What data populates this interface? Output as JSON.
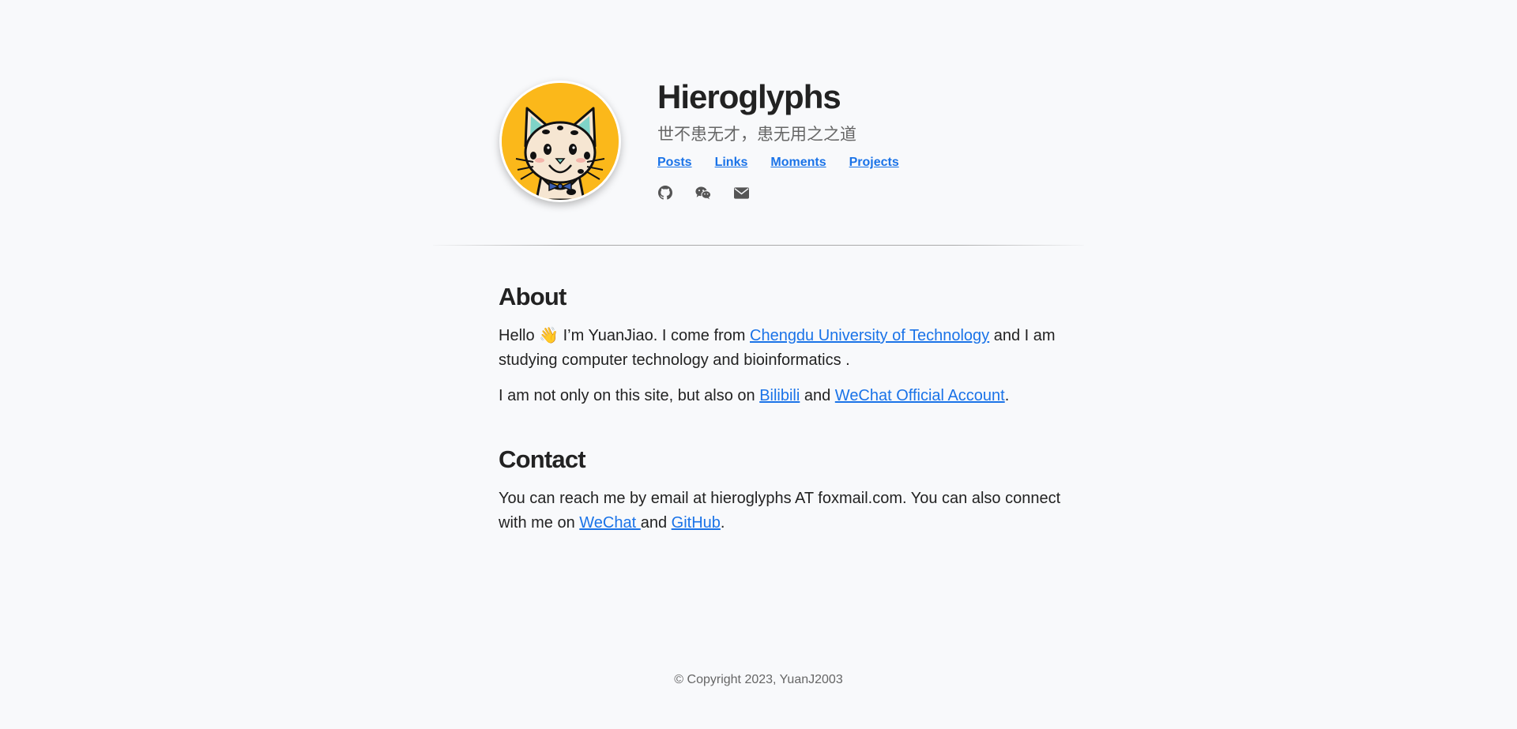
{
  "site": {
    "title": "Hieroglyphs",
    "description": "世不患无才，患无用之之道"
  },
  "nav": {
    "items": [
      {
        "label": "Posts"
      },
      {
        "label": "Links"
      },
      {
        "label": "Moments"
      },
      {
        "label": "Projects"
      }
    ]
  },
  "socials": [
    {
      "icon": "github-icon"
    },
    {
      "icon": "wechat-icon"
    },
    {
      "icon": "envelope-icon"
    }
  ],
  "about": {
    "heading": "About",
    "p1": {
      "before": "Hello",
      "emoji": "👋",
      "mid": " I’m YuanJiao. I come from ",
      "link": "Chengdu University of Technology",
      "after": " and I am studying computer technology and bioinformatics ."
    },
    "p2": {
      "before": "I am not only on this site, but also on ",
      "link1": "Bilibili",
      "mid": " and ",
      "link2": "WeChat Official Account",
      "after": "."
    }
  },
  "contact": {
    "heading": "Contact",
    "p": {
      "before": "You can reach me by email at hieroglyphs AT foxmail.com. You can also connect with me on ",
      "link1": "WeChat ",
      "mid": "and ",
      "link2": "GitHub",
      "after": "."
    }
  },
  "footer": {
    "text": "© Copyright 2023, YuanJ2003"
  },
  "colors": {
    "background": "#f8f9fb",
    "link": "#1a73e8",
    "avatar_bg": "#fbb81a",
    "icon": "#555555"
  }
}
